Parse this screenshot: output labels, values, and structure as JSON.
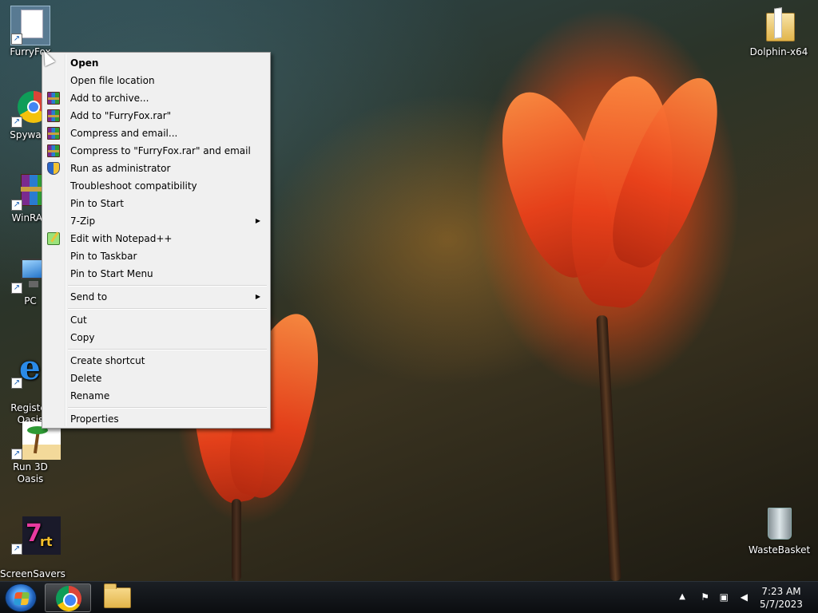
{
  "desktop": {
    "icons_left": [
      {
        "label": "FurryFox",
        "icon": "file-icon",
        "selected": true
      },
      {
        "label": "Spyware",
        "icon": "chrome-icon"
      },
      {
        "label": "WinRAR",
        "icon": "winrar-icon"
      },
      {
        "label": "PC",
        "icon": "computer-icon"
      },
      {
        "label": "Register\nOasis",
        "icon": "ie-icon"
      },
      {
        "label": "Run 3D Oasis",
        "icon": "palm-tree-icon"
      },
      {
        "label": "ScreenSavers\nManager",
        "icon": "screensaver-icon"
      }
    ],
    "icons_right": [
      {
        "label": "Dolphin-x64",
        "icon": "folder-icon"
      },
      {
        "label": "WasteBasket",
        "icon": "recycle-bin-icon"
      }
    ]
  },
  "context_menu": {
    "items": [
      {
        "label": "Open",
        "default": true
      },
      {
        "label": "Open file location"
      },
      {
        "label": "Add to archive...",
        "icon": "winrar-icon"
      },
      {
        "label": "Add to \"FurryFox.rar\"",
        "icon": "winrar-icon"
      },
      {
        "label": "Compress and email...",
        "icon": "winrar-icon"
      },
      {
        "label": "Compress to \"FurryFox.rar\" and email",
        "icon": "winrar-icon"
      },
      {
        "label": "Run as administrator",
        "icon": "uac-shield-icon"
      },
      {
        "label": "Troubleshoot compatibility"
      },
      {
        "label": "Pin to Start"
      },
      {
        "label": "7-Zip",
        "submenu": true
      },
      {
        "label": "Edit with Notepad++",
        "icon": "notepad-plus-plus-icon"
      },
      {
        "label": "Pin to Taskbar"
      },
      {
        "label": "Pin to Start Menu"
      },
      {
        "label": "Send to",
        "submenu": true
      },
      {
        "label": "Cut"
      },
      {
        "label": "Copy"
      },
      {
        "label": "Create shortcut"
      },
      {
        "label": "Delete"
      },
      {
        "label": "Rename"
      },
      {
        "label": "Properties"
      }
    ]
  },
  "taskbar": {
    "clock_time": "7:23 AM",
    "clock_date": "5/7/2023"
  }
}
